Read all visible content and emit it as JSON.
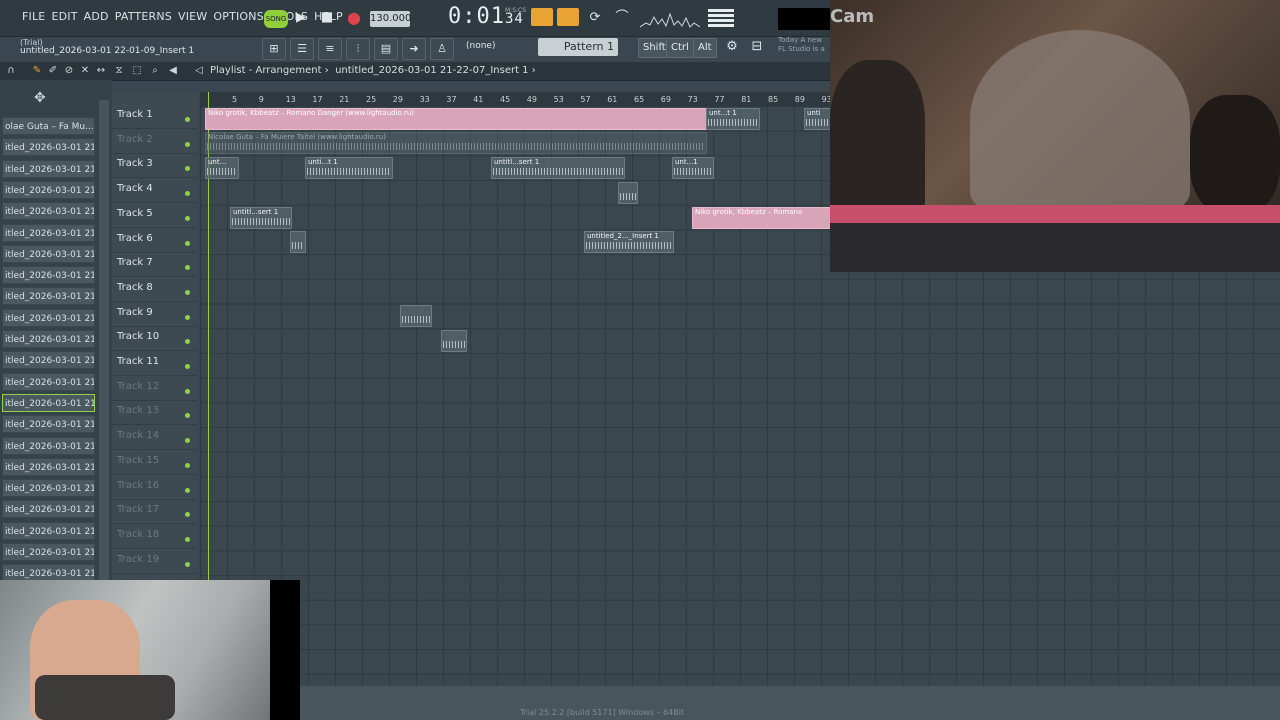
{
  "menu": [
    "FILE",
    "EDIT",
    "ADD",
    "PATTERNS",
    "VIEW",
    "OPTIONS",
    "TOOLS",
    "HELP"
  ],
  "song_mode": "SONG",
  "tempo": "130.000",
  "time": {
    "main": "0:01",
    "sub": "34",
    "unit": "M:S:CS"
  },
  "trial": "(Trial)",
  "project_name": "untitled_2026-03-01 22-01-09_Insert 1",
  "channel_selector": "(none)",
  "pattern": "Pattern 1",
  "keys": [
    "Shift",
    "Ctrl",
    "Alt"
  ],
  "hint": "Today A new FL Studio is a",
  "playlist": {
    "title": "Playlist - Arrangement",
    "breadcrumb": "untitled_2026-03-01 21-22-07_Insert 1"
  },
  "picker": [
    "olae Guta – Fa Mu...",
    "itled_2026-03-01 21-...",
    "itled_2026-03-01 21-...",
    "itled_2026-03-01 21-...",
    "itled_2026-03-01 21-...",
    "itled_2026-03-01 21-...",
    "itled_2026-03-01 21-...",
    "itled_2026-03-01 21-...",
    "itled_2026-03-01 21-...",
    "itled_2026-03-01 21-...",
    "itled_2026-03-01 21-...",
    "itled_2026-03-01 21-...",
    "itled_2026-03-01 21-...",
    "itled_2026-03-01 21-...",
    "itled_2026-03-01 21-...",
    "itled_2026-03-01 21-...",
    "itled_2026-03-01 21-...",
    "itled_2026-03-01 21-...",
    "itled_2026-03-01 21-...",
    "itled_2026-03-01 21-...",
    "itled_2026-03-01 21-...",
    "itled_2026-03-01 21-..."
  ],
  "tracks": [
    "Track 1",
    "Track 2",
    "Track 3",
    "Track 4",
    "Track 5",
    "Track 6",
    "Track 7",
    "Track 8",
    "Track 9",
    "Track 10",
    "Track 11",
    "Track 12",
    "Track 13",
    "Track 14",
    "Track 15",
    "Track 16",
    "Track 17",
    "Track 18",
    "Track 19"
  ],
  "ruler": [
    "5",
    "9",
    "13",
    "17",
    "21",
    "25",
    "29",
    "33",
    "37",
    "41",
    "45",
    "49",
    "53",
    "57",
    "61",
    "65",
    "69",
    "73",
    "77",
    "81",
    "85",
    "89",
    "93"
  ],
  "clips": {
    "t1_main": "Niko grotik, Kbbeatz – Romano Danger (www.lightaudio.ru)",
    "t1_b": "unt...t 1",
    "t1_c": "unti",
    "t2_main": "Nicolae Guta – Fa Muiere Taitei (www.lightaudio.ru)",
    "t3_a": "unt...",
    "t3_b": "unti...t 1",
    "t3_c": "untitl...sert 1",
    "t3_d": "unt...1",
    "t5_a": "untitl...sert 1",
    "t5_pink": "Niko grotik, Kbbeatz – Romano",
    "t6_a": "untitled_2..._Insert 1"
  },
  "cam_label": "Cam",
  "footer": "Trial  25.2.2 [build 5171]  Windows – 64Bit"
}
